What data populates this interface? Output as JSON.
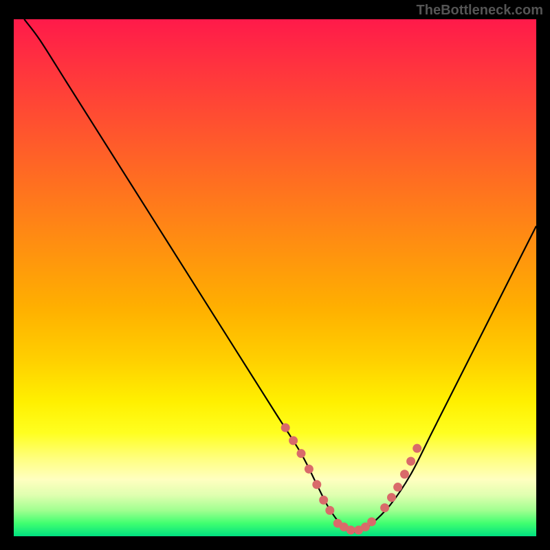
{
  "watermark": "TheBottleneck.com",
  "chart_data": {
    "type": "line",
    "title": "",
    "xlabel": "",
    "ylabel": "",
    "xlim": [
      0,
      100
    ],
    "ylim": [
      0,
      100
    ],
    "series": [
      {
        "name": "bottleneck-curve",
        "x": [
          2,
          5,
          10,
          15,
          20,
          25,
          30,
          35,
          40,
          45,
          50,
          55,
          58,
          60,
          62,
          64,
          66,
          68,
          72,
          76,
          80,
          85,
          90,
          95,
          100
        ],
        "y": [
          100,
          96,
          88,
          80,
          72,
          64,
          56,
          48,
          40,
          32,
          24,
          16,
          10,
          6,
          3,
          1,
          1,
          2,
          6,
          12,
          20,
          30,
          40,
          50,
          60
        ]
      }
    ],
    "markers": [
      {
        "name": "highlight-left",
        "color": "#d96a6a",
        "points": [
          {
            "x": 52,
            "y": 21
          },
          {
            "x": 53.5,
            "y": 18.5
          },
          {
            "x": 55,
            "y": 16
          },
          {
            "x": 56.5,
            "y": 13
          },
          {
            "x": 58,
            "y": 10
          },
          {
            "x": 59.3,
            "y": 7
          },
          {
            "x": 60.5,
            "y": 5
          }
        ]
      },
      {
        "name": "highlight-bottom",
        "color": "#d96a6a",
        "points": [
          {
            "x": 62,
            "y": 2.5
          },
          {
            "x": 63.2,
            "y": 1.8
          },
          {
            "x": 64.5,
            "y": 1.2
          },
          {
            "x": 66,
            "y": 1.2
          },
          {
            "x": 67.3,
            "y": 1.8
          },
          {
            "x": 68.5,
            "y": 2.8
          }
        ]
      },
      {
        "name": "highlight-right",
        "color": "#d96a6a",
        "points": [
          {
            "x": 71,
            "y": 5.5
          },
          {
            "x": 72.3,
            "y": 7.5
          },
          {
            "x": 73.5,
            "y": 9.5
          },
          {
            "x": 74.8,
            "y": 12
          },
          {
            "x": 76,
            "y": 14.5
          },
          {
            "x": 77.2,
            "y": 17
          }
        ]
      }
    ]
  }
}
